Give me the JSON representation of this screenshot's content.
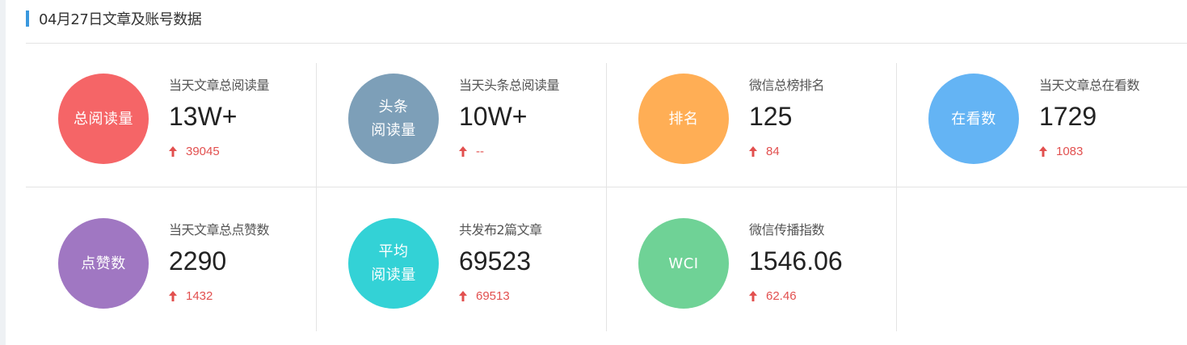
{
  "header": {
    "title": "04月27日文章及账号数据"
  },
  "colors": {
    "accent": "#3a98de",
    "up": "#e2504f"
  },
  "stats": [
    {
      "circle_label": "总阅读量",
      "circle_color": "#f56567",
      "label": "当天文章总阅读量",
      "value": "13W+",
      "change": "39045",
      "icon": "arrow-up-icon"
    },
    {
      "circle_label": "头条\n阅读量",
      "circle_color": "#7d9fb8",
      "label": "当天头条总阅读量",
      "value": "10W+",
      "change": "--",
      "icon": "arrow-up-icon"
    },
    {
      "circle_label": "排名",
      "circle_color": "#ffae55",
      "label": "微信总榜排名",
      "value": "125",
      "change": "84",
      "icon": "arrow-up-icon"
    },
    {
      "circle_label": "在看数",
      "circle_color": "#64b4f4",
      "label": "当天文章总在看数",
      "value": "1729",
      "change": "1083",
      "icon": "arrow-up-icon"
    },
    {
      "circle_label": "点赞数",
      "circle_color": "#a077c2",
      "label": "当天文章总点赞数",
      "value": "2290",
      "change": "1432",
      "icon": "arrow-up-icon"
    },
    {
      "circle_label": "平均\n阅读量",
      "circle_color": "#33d2d6",
      "label": "共发布2篇文章",
      "value": "69523",
      "change": "69513",
      "icon": "arrow-up-icon"
    },
    {
      "circle_label": "WCI",
      "circle_color": "#6fd296",
      "label": "微信传播指数",
      "value": "1546.06",
      "change": "62.46",
      "icon": "arrow-up-icon"
    }
  ]
}
